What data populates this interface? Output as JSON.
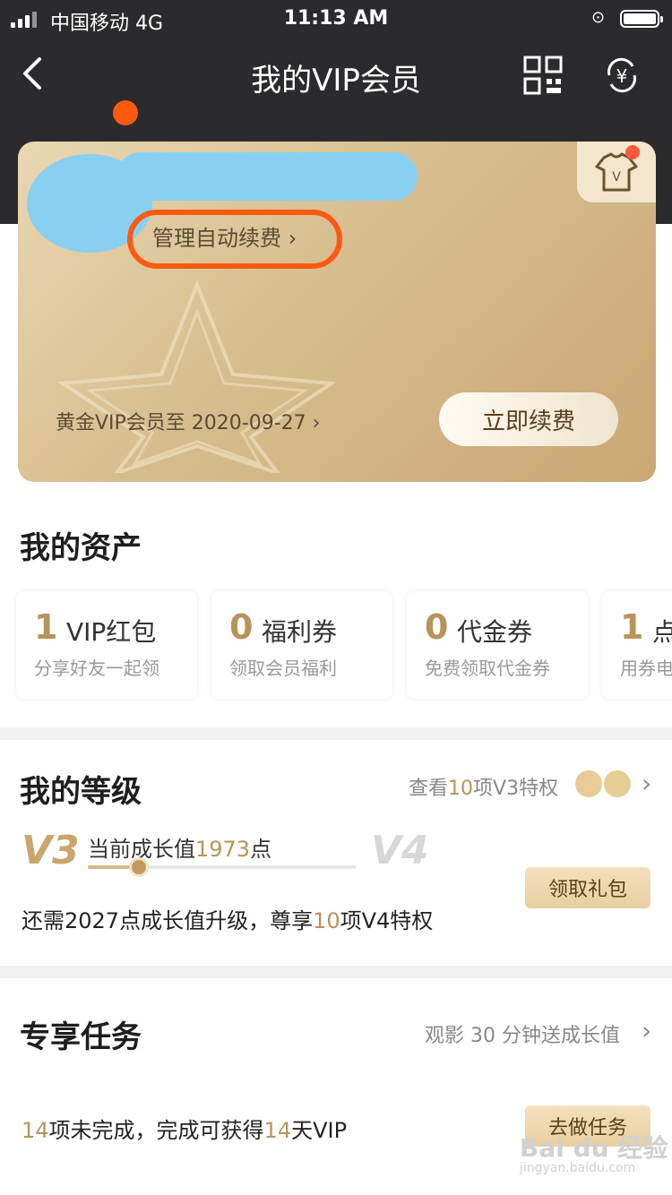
{
  "status_bar": {
    "carrier": "中国移动  4G",
    "time": "11:13 AM"
  },
  "nav": {
    "title": "我的VIP会员",
    "back_icon": "chevron-left-icon",
    "qr_icon": "qr-code-icon",
    "yen_icon": "currency-exchange-icon"
  },
  "vip_card": {
    "manage_label": "管理自动续费 ›",
    "expiry_label": "黄金VIP会员至 2020-09-27 ›",
    "renew_label": "立即续费",
    "accent": "#d7bd8e"
  },
  "assets": {
    "title": "我的资产",
    "items": [
      {
        "num": "1",
        "label": "VIP红包",
        "sub": "分享好友一起领"
      },
      {
        "num": "0",
        "label": "福利券",
        "sub": "领取会员福利"
      },
      {
        "num": "0",
        "label": "代金券",
        "sub": "免费领取代金券"
      },
      {
        "num": "1",
        "label": "点",
        "sub": "用券电"
      }
    ]
  },
  "level": {
    "title": "我的等级",
    "link_pre": "查看",
    "link_num": "10",
    "link_post": "项V3特权",
    "current_level": "V3",
    "next_level": "V4",
    "growth_pre": "当前成长值",
    "growth_value": "1973",
    "growth_post": "点",
    "progress": 0.19,
    "need_pre": "还需2027点成长值升级，尊享",
    "need_num": "10",
    "need_post": "项V4特权",
    "gift_button": "领取礼包"
  },
  "tasks": {
    "title": "专享任务",
    "link": "观影 30 分钟送成长值",
    "pending_num": "14",
    "pending_mid": "项未完成，完成可获得",
    "reward_num": "14",
    "reward_post": "天VIP",
    "button": "去做任务"
  },
  "watermark": {
    "brand": "Bai du 经验",
    "url": "jingyan.baidu.com"
  }
}
